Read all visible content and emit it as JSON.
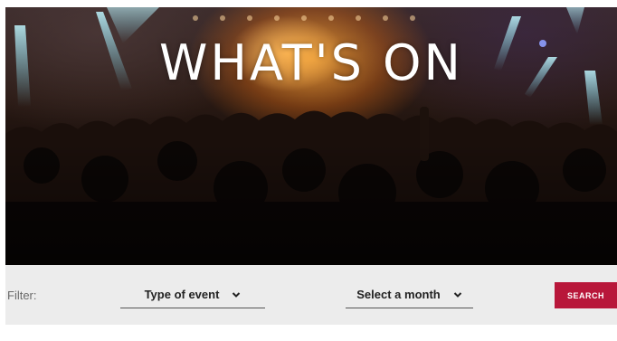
{
  "hero": {
    "title": "WHAT'S ON"
  },
  "filter": {
    "label": "Filter:",
    "event_type": {
      "selected": "Type of event",
      "icon": "chevron-down-icon"
    },
    "month": {
      "selected": "Select a month",
      "icon": "chevron-down-icon"
    },
    "search_label": "SEARCH"
  },
  "colors": {
    "accent": "#b8173a",
    "filter_bar_bg": "#ececec",
    "hero_text": "#ffffff"
  }
}
